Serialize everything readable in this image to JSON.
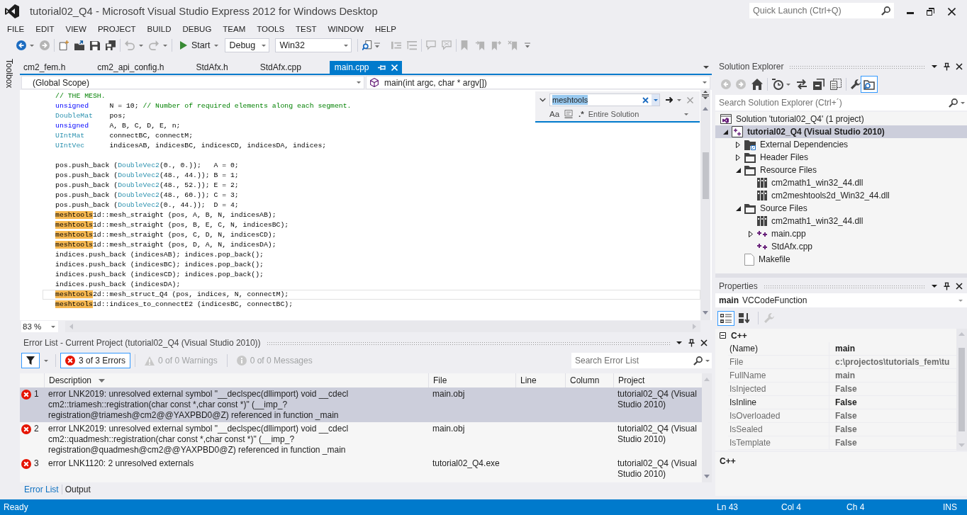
{
  "window": {
    "title": "tutorial02_Q4 - Microsoft Visual Studio Express 2012 for Windows Desktop"
  },
  "quick_launch": {
    "placeholder": "Quick Launch (Ctrl+Q)"
  },
  "menu": [
    "FILE",
    "EDIT",
    "VIEW",
    "PROJECT",
    "BUILD",
    "DEBUG",
    "TEAM",
    "TOOLS",
    "TEST",
    "WINDOW",
    "HELP"
  ],
  "toolbar": {
    "start": "Start",
    "configuration": "Debug",
    "platform": "Win32"
  },
  "toolbox_tab": "Toolbox",
  "document_tabs": [
    {
      "label": "cm2_fem.h",
      "selected": false
    },
    {
      "label": "cm2_api_config.h",
      "selected": false
    },
    {
      "label": "StdAfx.h",
      "selected": false
    },
    {
      "label": "StdAfx.cpp",
      "selected": false
    },
    {
      "label": "main.cpp",
      "selected": true
    }
  ],
  "navigation": {
    "scope": "(Global Scope)",
    "member": "main(int argc, char * argv[])"
  },
  "editor": {
    "lines": [
      {
        "current": false,
        "tokens": [
          {
            "kind": "comment",
            "text": "// THE MESH."
          }
        ]
      },
      {
        "current": false,
        "tokens": [
          {
            "kind": "keyword",
            "text": "unsigned"
          },
          {
            "kind": "plain",
            "text": "     N = 10; "
          },
          {
            "kind": "comment",
            "text": "// Number of required elements along each segment."
          }
        ]
      },
      {
        "current": false,
        "tokens": [
          {
            "kind": "type",
            "text": "DoubleMat"
          },
          {
            "kind": "plain",
            "text": "    pos;"
          }
        ]
      },
      {
        "current": false,
        "tokens": [
          {
            "kind": "keyword",
            "text": "unsigned"
          },
          {
            "kind": "plain",
            "text": "     A, B, C, D, E, n;"
          }
        ]
      },
      {
        "current": false,
        "tokens": [
          {
            "kind": "type",
            "text": "UIntMat"
          },
          {
            "kind": "plain",
            "text": "      connectBC, connectM;"
          }
        ]
      },
      {
        "current": false,
        "tokens": [
          {
            "kind": "type",
            "text": "UIntVec"
          },
          {
            "kind": "plain",
            "text": "      indicesAB, indicesBC, indicesCD, indicesDA, indices;"
          }
        ]
      },
      {
        "current": false
      },
      {
        "current": false,
        "tokens": [
          {
            "kind": "plain",
            "text": "pos.push_back ("
          },
          {
            "kind": "type",
            "text": "DoubleVec2"
          },
          {
            "kind": "plain",
            "text": "(0., 0.));   A = 0;"
          }
        ]
      },
      {
        "current": false,
        "tokens": [
          {
            "kind": "plain",
            "text": "pos.push_back ("
          },
          {
            "kind": "type",
            "text": "DoubleVec2"
          },
          {
            "kind": "plain",
            "text": "(48., 44.)); B = 1;"
          }
        ]
      },
      {
        "current": false,
        "tokens": [
          {
            "kind": "plain",
            "text": "pos.push_back ("
          },
          {
            "kind": "type",
            "text": "DoubleVec2"
          },
          {
            "kind": "plain",
            "text": "(48., 52.)); E = 2;"
          }
        ]
      },
      {
        "current": false,
        "tokens": [
          {
            "kind": "plain",
            "text": "pos.push_back ("
          },
          {
            "kind": "type",
            "text": "DoubleVec2"
          },
          {
            "kind": "plain",
            "text": "(48., 60.)); C = 3;"
          }
        ]
      },
      {
        "current": false,
        "tokens": [
          {
            "kind": "plain",
            "text": "pos.push_back ("
          },
          {
            "kind": "type",
            "text": "DoubleVec2"
          },
          {
            "kind": "plain",
            "text": "(0., 44.));  D = 4;"
          }
        ]
      },
      {
        "current": false,
        "tokens": [
          {
            "kind": "match",
            "text": "meshtools"
          },
          {
            "kind": "plain",
            "text": "1d::mesh_straight (pos, A, B, N, indicesAB);"
          }
        ]
      },
      {
        "current": false,
        "tokens": [
          {
            "kind": "match",
            "text": "meshtools"
          },
          {
            "kind": "plain",
            "text": "1d::mesh_straight (pos, B, E, C, N, indicesBC);"
          }
        ]
      },
      {
        "current": false,
        "tokens": [
          {
            "kind": "match",
            "text": "meshtools"
          },
          {
            "kind": "plain",
            "text": "1d::mesh_straight (pos, C, D, N, indicesCD);"
          }
        ]
      },
      {
        "current": false,
        "tokens": [
          {
            "kind": "match",
            "text": "meshtools"
          },
          {
            "kind": "plain",
            "text": "1d::mesh_straight (pos, D, A, N, indicesDA);"
          }
        ]
      },
      {
        "current": false,
        "tokens": [
          {
            "kind": "plain",
            "text": "indices.push_back (indicesAB); indices.pop_back();"
          }
        ]
      },
      {
        "current": false,
        "tokens": [
          {
            "kind": "plain",
            "text": "indices.push_back (indicesBC); indices.pop_back();"
          }
        ]
      },
      {
        "current": false,
        "tokens": [
          {
            "kind": "plain",
            "text": "indices.push_back (indicesCD); indices.pop_back();"
          }
        ]
      },
      {
        "current": false,
        "tokens": [
          {
            "kind": "plain",
            "text": "indices.push_back (indicesDA);"
          }
        ]
      },
      {
        "current": true,
        "tokens": [
          {
            "kind": "match",
            "text": "meshtools"
          },
          {
            "kind": "plain",
            "text": "2d::mesh_struct_Q4 (pos, indices, N, connectM);"
          }
        ]
      },
      {
        "current": false,
        "tokens": [
          {
            "kind": "match",
            "text": "meshtools"
          },
          {
            "kind": "plain",
            "text": "1d::indices_to_connectE2 (indicesBC, connectBC);"
          }
        ]
      }
    ],
    "zoom": "83 %"
  },
  "find": {
    "value": "meshtools",
    "match_case": "Aa",
    "regex": ".*",
    "scope": "Entire Solution"
  },
  "error_list": {
    "title": "Error List - Current Project (tutorial02_Q4 (Visual Studio 2010))",
    "filter_on": true,
    "filters": [
      {
        "kind": "error",
        "label": "3 of 3 Errors",
        "on": true,
        "disabled": false
      },
      {
        "kind": "warning",
        "label": "0 of 0 Warnings",
        "on": false,
        "disabled": true
      },
      {
        "kind": "message",
        "label": "0 of 0 Messages",
        "on": false,
        "disabled": true
      }
    ],
    "search": {
      "placeholder": "Search Error List"
    },
    "columns": [
      {
        "label": "Description",
        "sorted": true
      },
      {
        "label": "File",
        "sorted": false
      },
      {
        "label": "Line",
        "sorted": false
      },
      {
        "label": "Column",
        "sorted": false
      },
      {
        "label": "Project",
        "sorted": false
      }
    ],
    "rows": [
      {
        "number": "1",
        "description": "error LNK2019: unresolved external symbol \"__declspec(dllimport) void __cdecl cm2::triamesh::registration(char const *,char const *)\" (__imp_?registration@triamesh@cm2@@YAXPBD0@Z) referenced in function _main",
        "file": "main.obj",
        "project": "tutorial02_Q4 (Visual Studio 2010)",
        "selected": true
      },
      {
        "number": "2",
        "description": "error LNK2019: unresolved external symbol \"__declspec(dllimport) void __cdecl cm2::quadmesh::registration(char const *,char const *)\" (__imp_?registration@quadmesh@cm2@@YAXPBD0@Z) referenced in function _main",
        "file": "main.obj",
        "project": "tutorial02_Q4 (Visual Studio 2010)",
        "selected": false
      },
      {
        "number": "3",
        "description": "error LNK1120: 2 unresolved externals",
        "file": "tutorial02_Q4.exe",
        "project": "tutorial02_Q4 (Visual Studio 2010)",
        "selected": false
      }
    ],
    "tabs": [
      {
        "label": "Error List",
        "selected": true
      },
      {
        "label": "Output",
        "selected": false
      }
    ]
  },
  "solution_explorer": {
    "title": "Solution Explorer",
    "toggle_on": true,
    "search": {
      "placeholder": "Search Solution Explorer (Ctrl+´)"
    },
    "tree": [
      {
        "label": "Solution 'tutorial02_Q4' (1 project)",
        "kind": "solution",
        "selected": false,
        "children": [
          {
            "label": "tutorial02_Q4 (Visual Studio 2010)",
            "kind": "project",
            "selected": true,
            "expanded": true,
            "children": [
              {
                "label": "External Dependencies",
                "kind": "dependencies",
                "selected": false,
                "expanded": false
              },
              {
                "label": "Header Files",
                "kind": "folder",
                "selected": false,
                "expanded": false
              },
              {
                "label": "Resource Files",
                "kind": "folder",
                "selected": false,
                "expanded": true,
                "children": [
                  {
                    "label": "cm2math1_win32_44.dll",
                    "kind": "library",
                    "selected": false
                  },
                  {
                    "label": "cm2meshtools2d_Win32_44.dll",
                    "kind": "library",
                    "selected": false
                  }
                ]
              },
              {
                "label": "Source Files",
                "kind": "folder",
                "selected": false,
                "expanded": true,
                "children": [
                  {
                    "label": "cm2math1_win32_44.dll",
                    "kind": "library",
                    "selected": false
                  },
                  {
                    "label": "main.cpp",
                    "kind": "cpp",
                    "selected": false,
                    "expanded": false
                  },
                  {
                    "label": "StdAfx.cpp",
                    "kind": "cpp",
                    "selected": false
                  }
                ]
              },
              {
                "label": "Makefile",
                "kind": "file",
                "selected": false
              }
            ]
          }
        ]
      }
    ]
  },
  "properties": {
    "title": "Properties",
    "object_name": "main",
    "object_type": "VCCodeFunction",
    "categorized": true,
    "categories": [
      {
        "label": "C++",
        "expanded": true,
        "rows": [
          {
            "name": "(Name)",
            "value": "main",
            "readonly": false
          },
          {
            "name": "File",
            "value": "c:\\projectos\\tutorials_fem\\tu",
            "readonly": true
          },
          {
            "name": "FullName",
            "value": "main",
            "readonly": true
          },
          {
            "name": "IsInjected",
            "value": "False",
            "readonly": true
          },
          {
            "name": "IsInline",
            "value": "False",
            "readonly": false
          },
          {
            "name": "IsOverloaded",
            "value": "False",
            "readonly": true
          },
          {
            "name": "IsSealed",
            "value": "False",
            "readonly": true
          },
          {
            "name": "IsTemplate",
            "value": "False",
            "readonly": true
          }
        ]
      }
    ],
    "description": "C++"
  },
  "status_bar": {
    "message": "Ready",
    "line": "Ln 43",
    "column": "Col 4",
    "character": "Ch 4",
    "mode": "INS"
  }
}
